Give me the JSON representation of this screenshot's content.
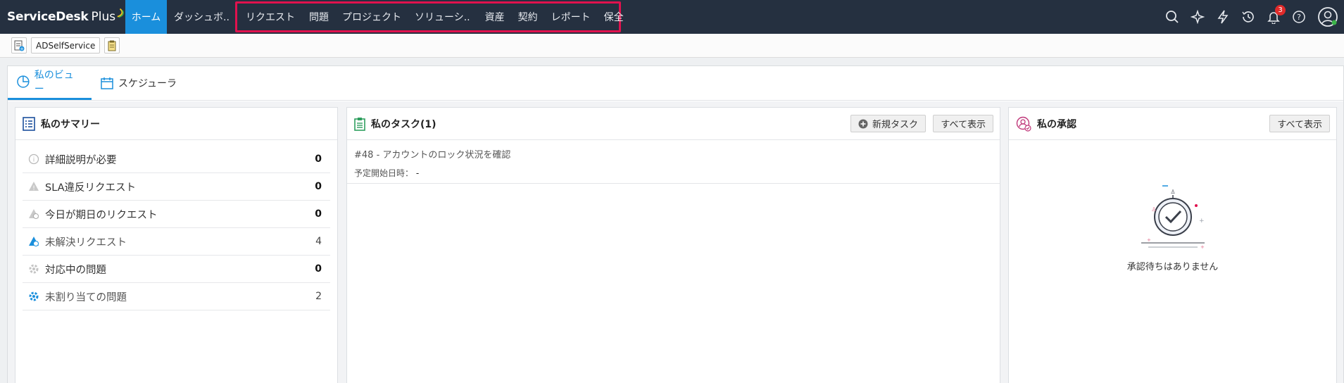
{
  "app": {
    "name_bold": "ServiceDesk",
    "name_plus": "Plus"
  },
  "nav": {
    "home": "ホーム",
    "dashboard": "ダッシュボ..",
    "items": [
      "リクエスト",
      "問題",
      "プロジェクト",
      "ソリューシ..",
      "資産",
      "契約",
      "レポート",
      "保全"
    ],
    "notification_count": "3",
    "highlight_color": "#e0124e",
    "accent_color": "#1a8fdc",
    "icons": [
      "search-icon",
      "sparkle-icon",
      "lightning-icon",
      "history-icon",
      "bell-icon",
      "help-icon",
      "user-avatar-icon"
    ]
  },
  "toolbar": {
    "adselfservice": "ADSelfService"
  },
  "tabs": {
    "my_view": "私のビュー",
    "scheduler": "スケジューラ"
  },
  "summary": {
    "title": "私のサマリー",
    "rows": [
      {
        "label": "詳細説明が必要",
        "count": "0"
      },
      {
        "label": "SLA違反リクエスト",
        "count": "0"
      },
      {
        "label": "今日が期日のリクエスト",
        "count": "0"
      },
      {
        "label": "未解決リクエスト",
        "count": "4"
      },
      {
        "label": "対応中の問題",
        "count": "0"
      },
      {
        "label": "未割り当ての問題",
        "count": "2"
      }
    ]
  },
  "tasks": {
    "title": "私のタスク(1)",
    "new_task": "新規タスク",
    "show_all": "すべて表示",
    "items": [
      {
        "title": "#48 - アカウントのロック状況を確認",
        "start_label": "予定開始日時：",
        "start_value": "-"
      }
    ]
  },
  "approvals": {
    "title": "私の承認",
    "show_all": "すべて表示",
    "empty": "承認待ちはありません"
  }
}
